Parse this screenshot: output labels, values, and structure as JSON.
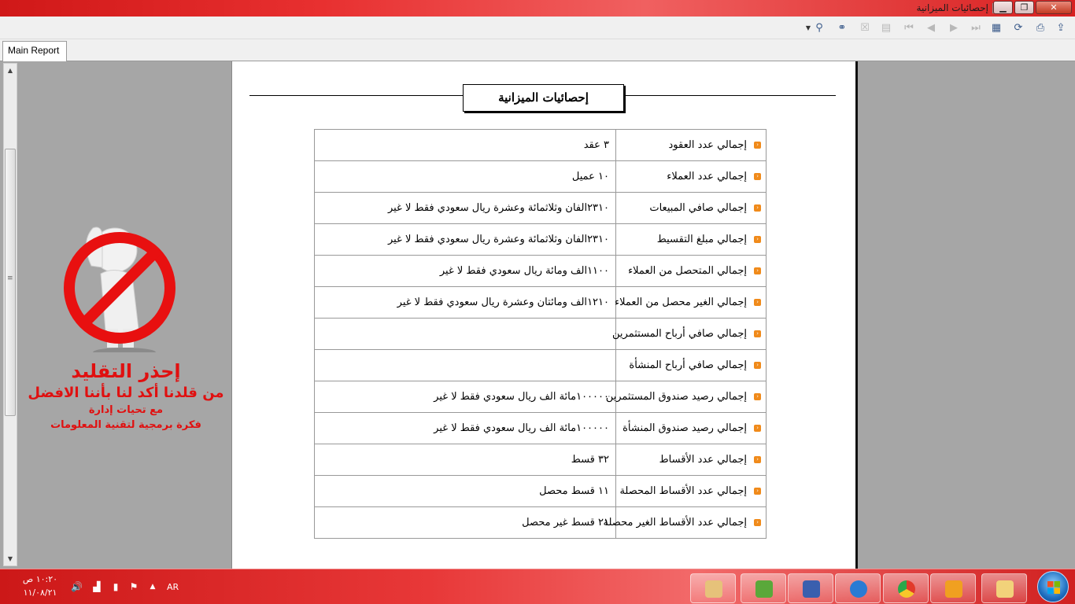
{
  "window": {
    "title": "إحصائيات الميزانية"
  },
  "tabs": [
    {
      "label": "Main Report"
    }
  ],
  "report": {
    "title": "إحصائيات الميزانية",
    "rows": [
      {
        "label": "إجمالي عدد العقود",
        "value": "٣ عقد"
      },
      {
        "label": "إجمالي عدد العملاء",
        "value": "١٠ عميل"
      },
      {
        "label": "إجمالي صافي المبيعات",
        "value": "٢٣١٠الفان وثلاثمائة وعشرة ريال سعودي فقط لا غير"
      },
      {
        "label": "إجمالي مبلغ التقسيط",
        "value": "٢٣١٠الفان وثلاثمائة وعشرة ريال سعودي فقط لا غير"
      },
      {
        "label": "إجمالي المتحصل من العملاء",
        "value": "١١٠٠الف ومائة ريال سعودي فقط لا غير"
      },
      {
        "label": "إجمالي الغير محصل من العملاء",
        "value": "١٢١٠الف ومائتان وعشرة ريال سعودي فقط لا غير"
      },
      {
        "label": "إجمالي صافي أرباح المستثمرين",
        "value": ""
      },
      {
        "label": "إجمالي صافي أرباح المنشأة",
        "value": ""
      },
      {
        "label": "إجمالي رصيد صندوق المستثمرين",
        "value": "١٠٠٠٠٠مائة الف ريال سعودي فقط لا غير"
      },
      {
        "label": "إجمالي رصيد صندوق المنشأة",
        "value": "١٠٠٠٠٠مائة الف ريال سعودي فقط لا غير"
      },
      {
        "label": "إجمالي عدد الأقساط",
        "value": "٣٢ قسط"
      },
      {
        "label": "إجمالي عدد الأقساط المحصلة",
        "value": "١١ قسط محصل"
      },
      {
        "label": "إجمالي عدد الأقساط الغير محصلة",
        "value": "٢١ قسط غير محصل"
      }
    ]
  },
  "warning": {
    "line1": "إحذر التقليد",
    "line2": "من قلدنا أكد لنا بأننا الافضل",
    "line3": "مع تحيات إدارة",
    "line4": "فكرة برمجية لتقنية المعلومات"
  },
  "taskbar": {
    "time": "١٠:٢٠ ص",
    "date": "١١/٠٨/٢١",
    "language": "AR"
  },
  "colors": {
    "accent_red": "#e01010",
    "bullet_orange": "#f08a1a",
    "taskbar_red": "#d82020"
  }
}
